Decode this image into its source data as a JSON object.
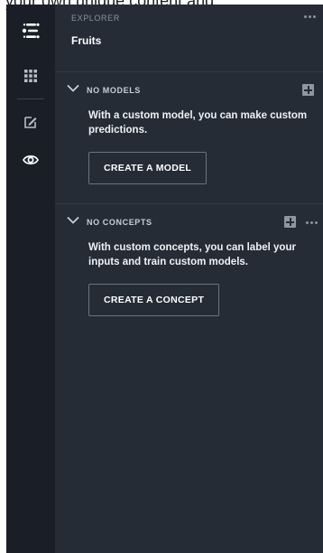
{
  "page_text": "your own unique content and",
  "rail": {
    "items": [
      {
        "name": "clarifai-logo-icon"
      },
      {
        "name": "apps-grid-icon"
      },
      {
        "name": "edit-icon"
      },
      {
        "name": "eye-icon"
      }
    ]
  },
  "explorer": {
    "eyebrow": "EXPLORER",
    "title": "Fruits"
  },
  "models": {
    "header": "NO MODELS",
    "description": "With a custom model, you can make custom predictions.",
    "button": "CREATE A MODEL"
  },
  "concepts": {
    "header": "NO CONCEPTS",
    "description": "With custom concepts, you can label your inputs and train custom models.",
    "button": "CREATE A CONCEPT"
  },
  "colors": {
    "rail_bg": "#1a1f27",
    "panel_bg": "#252c36",
    "text": "#ffffff",
    "muted": "#8a93a0"
  }
}
